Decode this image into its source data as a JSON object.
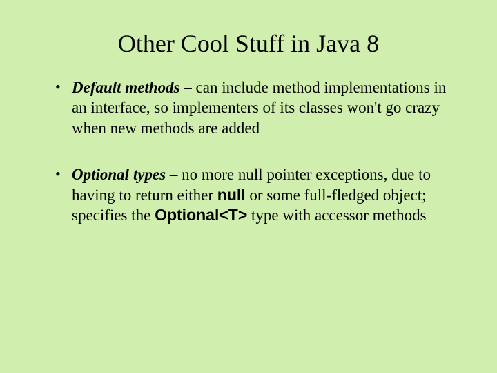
{
  "title": "Other Cool Stuff in Java 8",
  "bullets": [
    {
      "term": "Default methods",
      "sep": " – ",
      "body1": "can include method implementations in an interface, so implementers of its classes won't go crazy when new methods are added",
      "kw1": "",
      "body2": "",
      "kw2": "",
      "body3": ""
    },
    {
      "term": "Optional types",
      "sep": " – ",
      "body1": "no more null pointer exceptions, due to having to return either ",
      "kw1": "null",
      "body2": " or some full-fledged object; specifies the ",
      "kw2": "Optional<T>",
      "body3": " type with accessor methods"
    }
  ]
}
